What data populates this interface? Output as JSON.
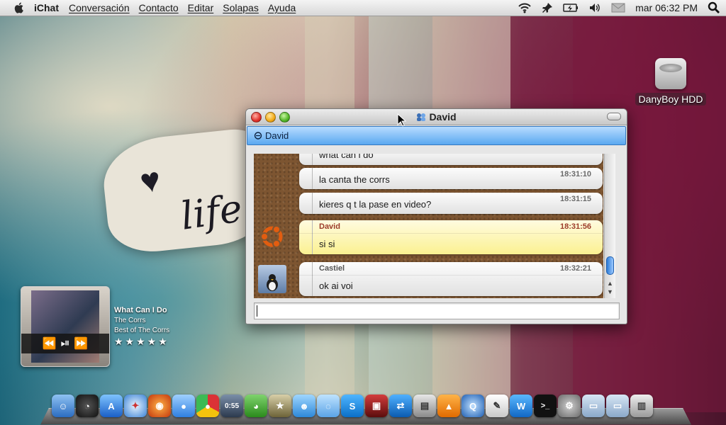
{
  "menubar": {
    "app_name": "iChat",
    "menus": [
      "Conversación",
      "Contacto",
      "Editar",
      "Solapas",
      "Ayuda"
    ],
    "clock": "mar 06:32 PM",
    "status_icons": [
      "wifi-icon",
      "pin-icon",
      "battery-icon",
      "volume-icon",
      "mail-icon",
      "search-icon"
    ]
  },
  "desktop": {
    "drive_label": "DanyBoy HDD"
  },
  "chat_window": {
    "title": "David",
    "tab_label": "David",
    "messages": [
      {
        "sender": "",
        "time": "",
        "text": "what can i do",
        "style": "gray"
      },
      {
        "sender": "",
        "time": "18:31:10",
        "text": "la canta the corrs",
        "style": "gray"
      },
      {
        "sender": "",
        "time": "18:31:15",
        "text": "kieres q t la pase en video?",
        "style": "gray"
      },
      {
        "sender": "David",
        "time": "18:31:56",
        "text": "si si",
        "style": "yellow"
      },
      {
        "sender": "Castiel",
        "time": "18:32:21",
        "text": "ok ai voi",
        "style": "gray"
      }
    ],
    "input_value": ""
  },
  "music_widget": {
    "song": "What Can I Do",
    "artist": "The Corrs",
    "album": "Best of The Corrs",
    "rating_stars": "★★★★★",
    "rating": 0
  },
  "dock": {
    "apps": [
      "finder-icon",
      "dashboard-icon",
      "app-store-icon",
      "safari-icon",
      "firefox-icon",
      "ichat-icon",
      "chrome-icon",
      "clock-icon",
      "adium-icon",
      "star-icon",
      "contacts-icon",
      "messages-icon",
      "skype-icon",
      "photo-booth-icon",
      "teamviewer-icon",
      "preview-icon",
      "vlc-icon",
      "quicktime-icon",
      "textedit-icon",
      "wunderlist-icon",
      "terminal-icon",
      "system-prefs-icon",
      "documents-folder-icon",
      "applications-folder-icon",
      "trash-icon"
    ]
  },
  "colors": {
    "tab_blue": "#5aa8f0",
    "ubuntu_orange": "#e25d10",
    "cork": "#7d5531"
  }
}
